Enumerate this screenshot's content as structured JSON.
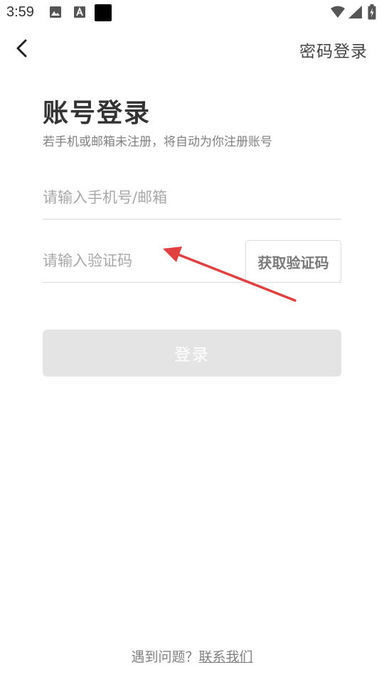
{
  "status_bar": {
    "time": "3:59",
    "notification_icons": [
      "image-icon",
      "font-icon",
      "black-square-icon"
    ],
    "system_icons": [
      "wifi-icon",
      "signal-icon",
      "battery-icon"
    ]
  },
  "nav": {
    "back_icon": "chevron-left-icon",
    "password_login_label": "密码登录"
  },
  "header": {
    "title": "账号登录",
    "subtitle": "若手机或邮箱未注册，将自动为你注册账号"
  },
  "form": {
    "phone_placeholder": "请输入手机号/邮箱",
    "phone_value": "",
    "code_placeholder": "请输入验证码",
    "code_value": "",
    "get_code_label": "获取验证码",
    "login_label": "登录"
  },
  "footer": {
    "question": "遇到问题？",
    "contact_label": "联系我们"
  },
  "colors": {
    "annotation_arrow": "#e04040",
    "login_button_disabled": "#e4e4e4",
    "text_primary": "#333333",
    "text_secondary": "#808080"
  }
}
